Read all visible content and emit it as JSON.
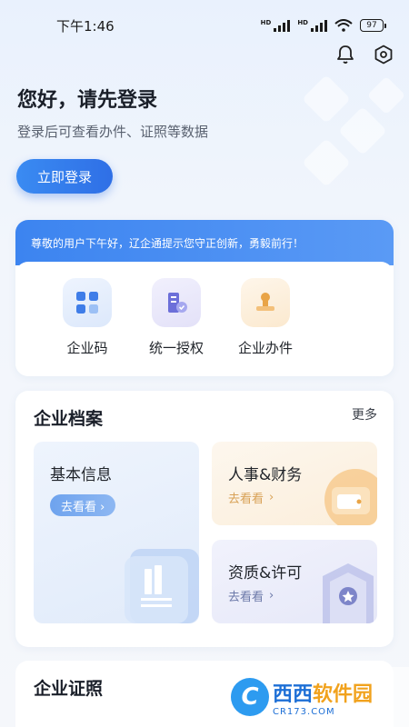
{
  "status_bar": {
    "time": "下午1:46",
    "battery": "97",
    "hd_label": "HD"
  },
  "header": {
    "bell_icon": "bell-icon",
    "settings_icon": "settings-icon"
  },
  "greeting": {
    "title": "您好，请先登录",
    "subtitle": "登录后可查看办件、证照等数据",
    "login_button": "立即登录"
  },
  "quick": {
    "banner": "尊敬的用户下午好，辽企通提示您守正创新，勇毅前行！",
    "items": [
      {
        "label": "企业码",
        "icon": "qr-grid-icon"
      },
      {
        "label": "统一授权",
        "icon": "building-shield-icon"
      },
      {
        "label": "企业办件",
        "icon": "stamp-icon"
      }
    ]
  },
  "archive": {
    "title": "企业档案",
    "more": "更多",
    "tiles": [
      {
        "title": "基本信息",
        "action": "去看看 ›"
      },
      {
        "title": "人事&财务",
        "action": "去看看"
      },
      {
        "title": "资质&许可",
        "action": "去看看"
      }
    ]
  },
  "certificates": {
    "title": "企业证照"
  },
  "watermark": {
    "logo": "C",
    "main_a": "西西",
    "main_b": "软件园",
    "sub": "CR173.COM"
  },
  "colors": {
    "accent": "#2f6fe6",
    "banner": "#3c84f0",
    "hr_accent": "#d8a156",
    "qual_accent": "#6b78a8"
  }
}
